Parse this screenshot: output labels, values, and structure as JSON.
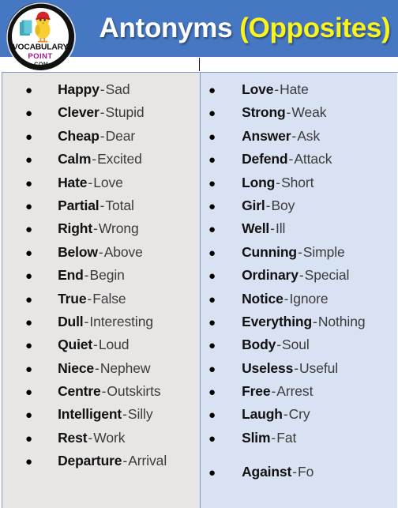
{
  "header": {
    "title_main": "Antonyms",
    "title_accent": "(Opposites)",
    "background_color": "#4577c3",
    "title_color": "#ffffff",
    "accent_color": "#f9f41c"
  },
  "logo": {
    "line1": "VOCABULARY",
    "line2": "POINT",
    "line3": ".COM",
    "line1_color": "#111111",
    "line2_color": "#a01a8d",
    "line3_color": "#1a1a1a",
    "ring_color": "#111111",
    "face_color": "#ffffff",
    "chick_color": "#f4c928",
    "cap_color": "#d8232a",
    "book_color": "#46b6c4"
  },
  "table": {
    "separator": "-",
    "left_column": {
      "background_color": "#e8e6e5",
      "rows": [
        {
          "word": "Happy",
          "opposite": "Sad"
        },
        {
          "word": "Clever",
          "opposite": "Stupid"
        },
        {
          "word": "Cheap",
          "opposite": "Dear"
        },
        {
          "word": "Calm",
          "opposite": "Excited"
        },
        {
          "word": "Hate",
          "opposite": "Love"
        },
        {
          "word": "Partial",
          "opposite": "Total"
        },
        {
          "word": "Right",
          "opposite": "Wrong"
        },
        {
          "word": "Below",
          "opposite": "Above"
        },
        {
          "word": "End",
          "opposite": "Begin"
        },
        {
          "word": "True",
          "opposite": "False"
        },
        {
          "word": "Dull",
          "opposite": "Interesting"
        },
        {
          "word": "Quiet",
          "opposite": "Loud"
        },
        {
          "word": "Niece",
          "opposite": "Nephew"
        },
        {
          "word": "Centre",
          "opposite": "Outskirts"
        },
        {
          "word": "Intelligent",
          "opposite": "Silly"
        },
        {
          "word": "Rest",
          "opposite": "Work"
        },
        {
          "word": "Departure",
          "opposite": "Arrival"
        }
      ]
    },
    "right_column": {
      "background_color": "#d9e2f3",
      "rows": [
        {
          "word": "Love",
          "opposite": "Hate"
        },
        {
          "word": "Strong",
          "opposite": "Weak"
        },
        {
          "word": "Answer",
          "opposite": "Ask"
        },
        {
          "word": "Defend",
          "opposite": "Attack"
        },
        {
          "word": "Long",
          "opposite": "Short"
        },
        {
          "word": "Girl",
          "opposite": "Boy"
        },
        {
          "word": "Well",
          "opposite": "Ill"
        },
        {
          "word": "Cunning",
          "opposite": "Simple"
        },
        {
          "word": "Ordinary",
          "opposite": "Special"
        },
        {
          "word": "Notice",
          "opposite": "Ignore"
        },
        {
          "word": "Everything",
          "opposite": "Nothing"
        },
        {
          "word": "Body",
          "opposite": "Soul"
        },
        {
          "word": "Useless",
          "opposite": "Useful"
        },
        {
          "word": "Free",
          "opposite": "Arrest"
        },
        {
          "word": "Laugh",
          "opposite": "Cry"
        },
        {
          "word": "Slim",
          "opposite": "Fat"
        },
        {
          "word": "Against",
          "opposite": "Fo",
          "extra_gap": true
        }
      ]
    }
  }
}
